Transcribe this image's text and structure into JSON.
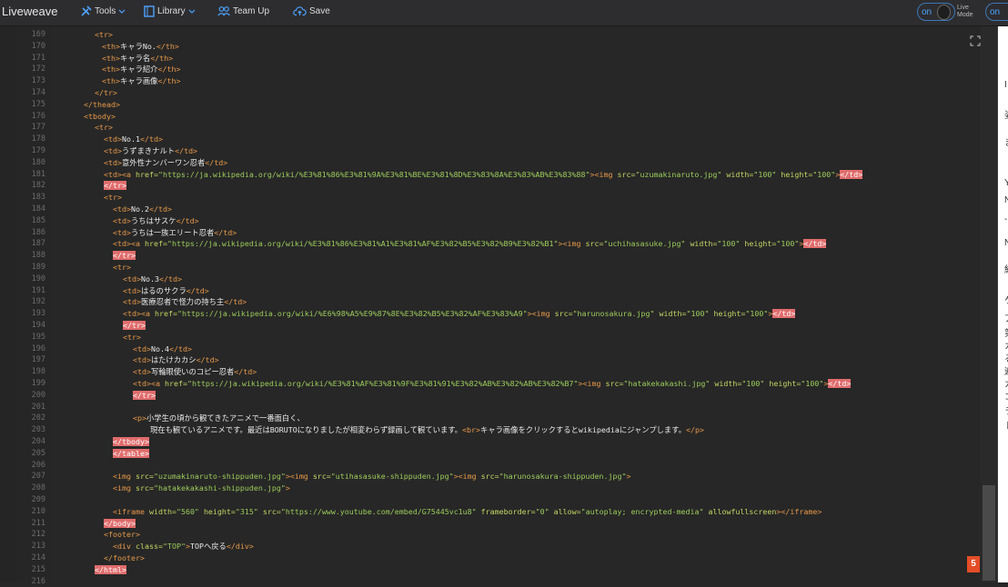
{
  "app": {
    "title": "Liveweave"
  },
  "toolbar": {
    "tools": "Tools",
    "library": "Library",
    "team": "Team Up",
    "save": "Save",
    "live_on": "on",
    "live_mode": "Live\nMode",
    "on2": "on"
  },
  "badge": {
    "html5": "5"
  },
  "preview": {
    "glyphs": [
      "I",
      "姿",
      "ま",
      "Y",
      "N",
      "-",
      "N",
      "紹",
      "ケ",
      "ア",
      "第",
      "カ",
      "る",
      "遍",
      "カ",
      "コ",
      "ラ",
      "ト"
    ]
  },
  "code": {
    "line_numbers": [
      "169",
      "170",
      "171",
      "172",
      "173",
      "174",
      "175",
      "176",
      "177",
      "178",
      "179",
      "180",
      "181",
      "182",
      "183",
      "184",
      "185",
      "186",
      "187",
      "188",
      "189",
      "190",
      "191",
      "192",
      "193",
      "194",
      "195",
      "196",
      "197",
      "198",
      "199",
      "200",
      "201",
      "202",
      "203",
      "204",
      "205",
      "206",
      "207",
      "208",
      "209",
      "210",
      "211",
      "212",
      "213",
      "214",
      "215",
      "216"
    ],
    "lines": [
      [
        {
          "t": "t",
          "v": "<tr>"
        }
      ],
      [
        {
          "t": "t",
          "v": "<th>"
        },
        {
          "t": "x",
          "v": "キャラNo."
        },
        {
          "t": "t",
          "v": "</th>"
        }
      ],
      [
        {
          "t": "t",
          "v": "<th>"
        },
        {
          "t": "x",
          "v": "キャラ名"
        },
        {
          "t": "t",
          "v": "</th>"
        }
      ],
      [
        {
          "t": "t",
          "v": "<th>"
        },
        {
          "t": "x",
          "v": "キャラ紹介"
        },
        {
          "t": "t",
          "v": "</th>"
        }
      ],
      [
        {
          "t": "t",
          "v": "<th>"
        },
        {
          "t": "x",
          "v": "キャラ画像"
        },
        {
          "t": "t",
          "v": "</th>"
        }
      ],
      [
        {
          "t": "t",
          "v": "</tr>"
        }
      ],
      [
        {
          "t": "t",
          "v": "</thead>"
        }
      ],
      [
        {
          "t": "t",
          "v": "<tbody>"
        }
      ],
      [
        {
          "t": "t",
          "v": "<tr>"
        }
      ],
      [
        {
          "t": "t",
          "v": "<td>"
        },
        {
          "t": "x",
          "v": "No.1"
        },
        {
          "t": "t",
          "v": "</td>"
        }
      ],
      [
        {
          "t": "t",
          "v": "<td>"
        },
        {
          "t": "x",
          "v": "うずまきナルト"
        },
        {
          "t": "t",
          "v": "</td>"
        }
      ],
      [
        {
          "t": "t",
          "v": "<td>"
        },
        {
          "t": "x",
          "v": "意外性ナンバーワン忍者"
        },
        {
          "t": "t",
          "v": "</td>"
        }
      ],
      [
        {
          "t": "t",
          "v": "<td><a "
        },
        {
          "t": "a",
          "v": "href="
        },
        {
          "t": "s",
          "v": "\"https://ja.wikipedia.org/wiki/%E3%81%86%E3%81%9A%E3%81%BE%E3%81%8D%E3%83%8A%E3%83%AB%E3%83%88\""
        },
        {
          "t": "t",
          "v": "><img "
        },
        {
          "t": "a",
          "v": "src="
        },
        {
          "t": "s",
          "v": "\"uzumakinaruto.jpg\" "
        },
        {
          "t": "a",
          "v": "width="
        },
        {
          "t": "s",
          "v": "\"100\" "
        },
        {
          "t": "a",
          "v": "height="
        },
        {
          "t": "s",
          "v": "\"100\""
        },
        {
          "t": "t",
          "v": ">"
        },
        {
          "t": "err",
          "v": "</td>"
        }
      ],
      [
        {
          "t": "err",
          "v": "</tr>"
        }
      ],
      [
        {
          "t": "t",
          "v": "<tr>"
        }
      ],
      [
        {
          "t": "t",
          "v": "<td>"
        },
        {
          "t": "x",
          "v": "No.2"
        },
        {
          "t": "t",
          "v": "</td>"
        }
      ],
      [
        {
          "t": "t",
          "v": "<td>"
        },
        {
          "t": "x",
          "v": "うちはサスケ"
        },
        {
          "t": "t",
          "v": "</td>"
        }
      ],
      [
        {
          "t": "t",
          "v": "<td>"
        },
        {
          "t": "x",
          "v": "うちは一族エリート忍者"
        },
        {
          "t": "t",
          "v": "</td>"
        }
      ],
      [
        {
          "t": "t",
          "v": "<td><a "
        },
        {
          "t": "a",
          "v": "href="
        },
        {
          "t": "s",
          "v": "\"https://ja.wikipedia.org/wiki/%E3%81%86%E3%81%A1%E3%81%AF%E3%82%B5%E3%82%B9%E3%82%B1\""
        },
        {
          "t": "t",
          "v": "><img "
        },
        {
          "t": "a",
          "v": "src="
        },
        {
          "t": "s",
          "v": "\"uchihasasuke.jpg\" "
        },
        {
          "t": "a",
          "v": "width="
        },
        {
          "t": "s",
          "v": "\"100\" "
        },
        {
          "t": "a",
          "v": "height="
        },
        {
          "t": "s",
          "v": "\"100\""
        },
        {
          "t": "t",
          "v": ">"
        },
        {
          "t": "err",
          "v": "</td>"
        }
      ],
      [
        {
          "t": "err",
          "v": "</tr>"
        }
      ],
      [
        {
          "t": "t",
          "v": "<tr>"
        }
      ],
      [
        {
          "t": "t",
          "v": "<td>"
        },
        {
          "t": "x",
          "v": "No.3"
        },
        {
          "t": "t",
          "v": "</td>"
        }
      ],
      [
        {
          "t": "t",
          "v": "<td>"
        },
        {
          "t": "x",
          "v": "はるのサクラ"
        },
        {
          "t": "t",
          "v": "</td>"
        }
      ],
      [
        {
          "t": "t",
          "v": "<td>"
        },
        {
          "t": "x",
          "v": "医療忍者で怪力の持ち主"
        },
        {
          "t": "t",
          "v": "</td>"
        }
      ],
      [
        {
          "t": "t",
          "v": "<td><a "
        },
        {
          "t": "a",
          "v": "href="
        },
        {
          "t": "s",
          "v": "\"https://ja.wikipedia.org/wiki/%E6%98%A5%E9%87%8E%E3%82%B5%E3%82%AF%E3%83%A9\""
        },
        {
          "t": "t",
          "v": "><img "
        },
        {
          "t": "a",
          "v": "src="
        },
        {
          "t": "s",
          "v": "\"harunosakura.jpg\" "
        },
        {
          "t": "a",
          "v": "width="
        },
        {
          "t": "s",
          "v": "\"100\" "
        },
        {
          "t": "a",
          "v": "height="
        },
        {
          "t": "s",
          "v": "\"100\""
        },
        {
          "t": "t",
          "v": ">"
        },
        {
          "t": "err",
          "v": "</td>"
        }
      ],
      [
        {
          "t": "err",
          "v": "</tr>"
        }
      ],
      [
        {
          "t": "t",
          "v": "<tr>"
        }
      ],
      [
        {
          "t": "t",
          "v": "<td>"
        },
        {
          "t": "x",
          "v": "No.4"
        },
        {
          "t": "t",
          "v": "</td>"
        }
      ],
      [
        {
          "t": "t",
          "v": "<td>"
        },
        {
          "t": "x",
          "v": "はたけカカシ"
        },
        {
          "t": "t",
          "v": "</td>"
        }
      ],
      [
        {
          "t": "t",
          "v": "<td>"
        },
        {
          "t": "x",
          "v": "写輪眼使いのコピー忍者"
        },
        {
          "t": "t",
          "v": "</td>"
        }
      ],
      [
        {
          "t": "t",
          "v": "<td><a "
        },
        {
          "t": "a",
          "v": "href="
        },
        {
          "t": "s",
          "v": "\"https://ja.wikipedia.org/wiki/%E3%81%AF%E3%81%9F%E3%81%91%E3%82%AB%E3%82%AB%E3%82%B7\""
        },
        {
          "t": "t",
          "v": "><img "
        },
        {
          "t": "a",
          "v": "src="
        },
        {
          "t": "s",
          "v": "\"hatakekakashi.jpg\" "
        },
        {
          "t": "a",
          "v": "width="
        },
        {
          "t": "s",
          "v": "\"100\" "
        },
        {
          "t": "a",
          "v": "height="
        },
        {
          "t": "s",
          "v": "\"100\""
        },
        {
          "t": "t",
          "v": ">"
        },
        {
          "t": "err",
          "v": "</td>"
        }
      ],
      [
        {
          "t": "err",
          "v": "</tr>"
        }
      ],
      [],
      [
        {
          "t": "t",
          "v": "<p>"
        },
        {
          "t": "x",
          "v": "小学生の頃から観てきたアニメで一番面白く、"
        }
      ],
      [
        {
          "t": "x",
          "v": "  現在も観ているアニメです。最近はBORUTOになりましたが相変わらず録画して観ています。"
        },
        {
          "t": "t",
          "v": "<br>"
        },
        {
          "t": "x",
          "v": "キャラ画像をクリックするとwikipediaにジャンプします。"
        },
        {
          "t": "t",
          "v": "</p>"
        }
      ],
      [
        {
          "t": "err",
          "v": "</tbody>"
        }
      ],
      [
        {
          "t": "err",
          "v": "</table>"
        }
      ],
      [],
      [
        {
          "t": "t",
          "v": "<img "
        },
        {
          "t": "a",
          "v": "src="
        },
        {
          "t": "s",
          "v": "\"uzumakinaruto-shippuden.jpg\""
        },
        {
          "t": "t",
          "v": "><img "
        },
        {
          "t": "a",
          "v": "src="
        },
        {
          "t": "s",
          "v": "\"utihasasuke-shippuden.jpg\""
        },
        {
          "t": "t",
          "v": "><img "
        },
        {
          "t": "a",
          "v": "src="
        },
        {
          "t": "s",
          "v": "\"harunosakura-shippuden.jpg\""
        },
        {
          "t": "t",
          "v": ">"
        }
      ],
      [
        {
          "t": "t",
          "v": "<img "
        },
        {
          "t": "a",
          "v": "src="
        },
        {
          "t": "s",
          "v": "\"hatakekakashi-shippuden.jpg\""
        },
        {
          "t": "t",
          "v": ">"
        }
      ],
      [],
      [
        {
          "t": "t",
          "v": "<iframe "
        },
        {
          "t": "a",
          "v": "width="
        },
        {
          "t": "s",
          "v": "\"560\" "
        },
        {
          "t": "a",
          "v": "height="
        },
        {
          "t": "s",
          "v": "\"315\" "
        },
        {
          "t": "a",
          "v": "src="
        },
        {
          "t": "s",
          "v": "\"https://www.youtube.com/embed/G75445vc1u8\" "
        },
        {
          "t": "a",
          "v": "frameborder="
        },
        {
          "t": "s",
          "v": "\"0\" "
        },
        {
          "t": "a",
          "v": "allow="
        },
        {
          "t": "s",
          "v": "\"autoplay; encrypted-media\" "
        },
        {
          "t": "a",
          "v": "allowfullscreen"
        },
        {
          "t": "t",
          "v": "></iframe>"
        }
      ],
      [
        {
          "t": "err",
          "v": "</body>"
        }
      ],
      [
        {
          "t": "t",
          "v": "<footer>"
        }
      ],
      [
        {
          "t": "t",
          "v": "<div "
        },
        {
          "t": "a",
          "v": "class="
        },
        {
          "t": "s",
          "v": "\"TOP\""
        },
        {
          "t": "t",
          "v": ">"
        },
        {
          "t": "x",
          "v": "TOPへ戻る"
        },
        {
          "t": "t",
          "v": "</div>"
        }
      ],
      [
        {
          "t": "t",
          "v": "</footer>"
        }
      ],
      [
        {
          "t": "err",
          "v": "</html>"
        }
      ],
      []
    ]
  }
}
